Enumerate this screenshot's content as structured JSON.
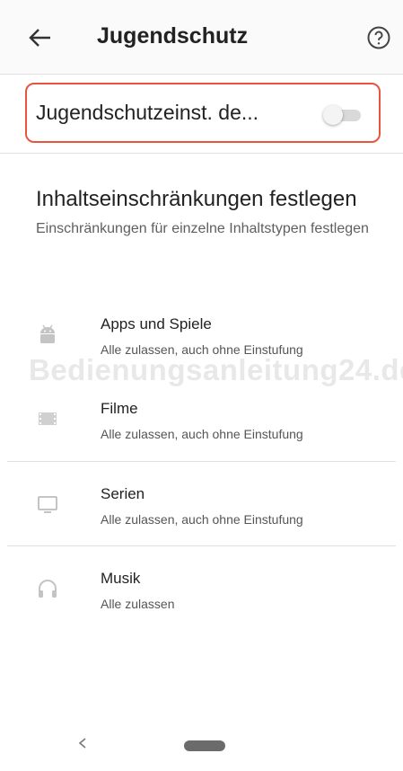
{
  "header": {
    "title": "Jugendschutz"
  },
  "parental_toggle": {
    "label": "Jugendschutzeinst. de...",
    "enabled": false
  },
  "content_restrictions": {
    "title": "Inhaltseinschränkungen festlegen",
    "subtitle": "Einschränkungen für einzelne Inhaltstypen festlegen"
  },
  "items": [
    {
      "name": "Apps und Spiele",
      "desc": "Alle zulassen, auch ohne Einstufung",
      "icon": "android-icon"
    },
    {
      "name": "Filme",
      "desc": "Alle zulassen, auch ohne Einstufung",
      "icon": "film-icon"
    },
    {
      "name": "Serien",
      "desc": "Alle zulassen, auch ohne Einstufung",
      "icon": "tv-icon"
    },
    {
      "name": "Musik",
      "desc": "Alle zulassen",
      "icon": "headphones-icon"
    }
  ],
  "watermark": "Bedienungsanleitung24.de"
}
